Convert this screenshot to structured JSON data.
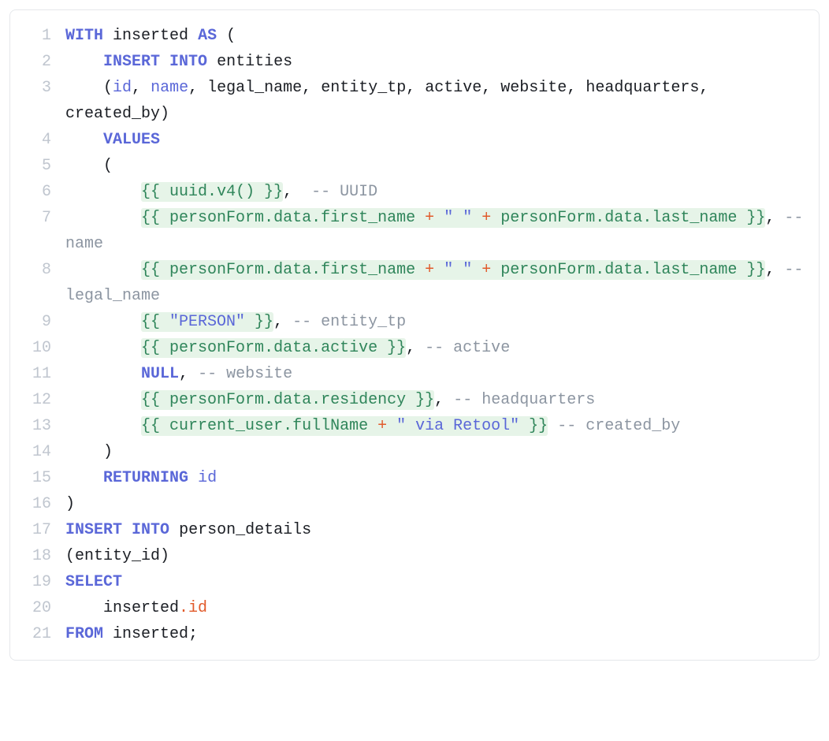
{
  "gutter": [
    "1",
    "2",
    "3",
    "4",
    "5",
    "6",
    "7",
    "8",
    "9",
    "10",
    "11",
    "12",
    "13",
    "14",
    "15",
    "16",
    "17",
    "18",
    "19",
    "20",
    "21"
  ],
  "kw": {
    "WITH": "WITH",
    "AS": "AS",
    "INSERT": "INSERT",
    "INTO": "INTO",
    "VALUES": "VALUES",
    "RETURNING": "RETURNING",
    "SELECT": "SELECT",
    "FROM": "FROM",
    "NULL": "NULL"
  },
  "id": {
    "inserted": "inserted",
    "entities": "entities",
    "person_details": "person_details",
    "entity_id": "entity_id",
    "id": "id",
    "name": "name",
    "legal_name": "legal_name",
    "entity_tp": "entity_tp",
    "active": "active",
    "website": "website",
    "headquarters": "headquarters",
    "created_by": "created_by"
  },
  "tpl": {
    "open": "{{ ",
    "close": " }}",
    "uuid": "uuid",
    "v4": "v4()",
    "personForm": "personForm",
    "data": "data",
    "first_name": "first_name",
    "last_name": "last_name",
    "activeField": "active",
    "residency": "residency",
    "current_user": "current_user",
    "fullName": "fullName"
  },
  "str": {
    "space": "\" \"",
    "person": "\"PERSON\"",
    "viaRetool": "\" via Retool\""
  },
  "op": {
    "plus": "+"
  },
  "punct": {
    "dot": ".",
    "comma": ",",
    "lparen": "(",
    "rparen": ")",
    "semicolon": ";"
  },
  "cmt": {
    "uuid": "-- UUID",
    "name": "-- name",
    "legal_name": "-- legal_name",
    "entity_tp": "-- entity_tp",
    "active": "-- active",
    "website": "-- website",
    "headquarters": "-- headquarters",
    "created_by": "-- created_by"
  },
  "ws": {
    "sp": " ",
    "indent1": "    ",
    "indent2": "        ",
    "commaSpNbsp": ",  "
  }
}
